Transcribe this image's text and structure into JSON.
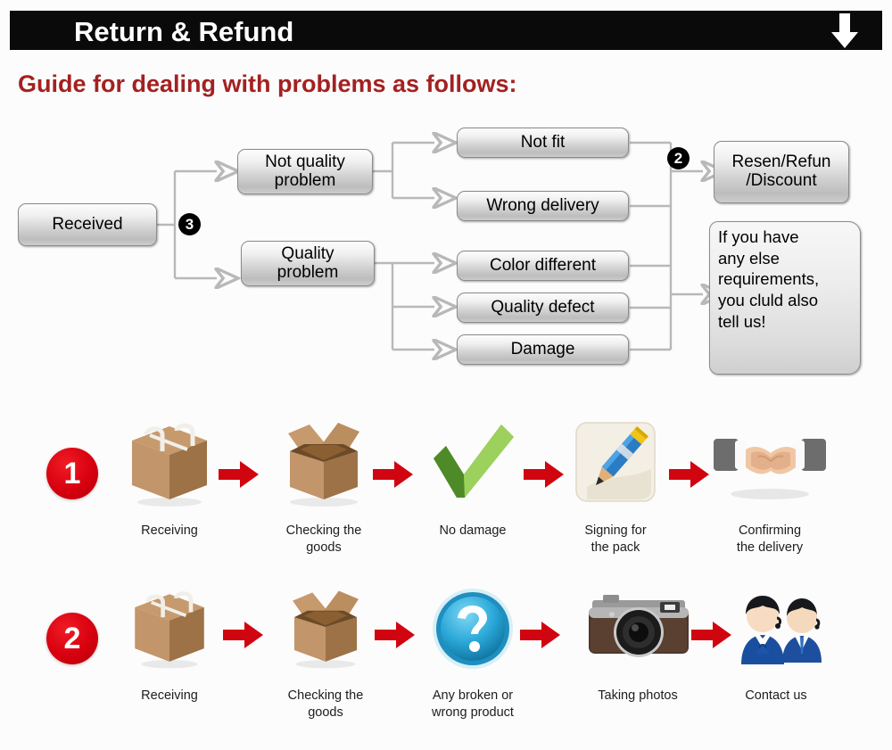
{
  "banner": {
    "title": "Return & Refund",
    "arrow_icon": "down-arrow-icon"
  },
  "guide": {
    "title": "Guide for dealing with problems as follows:"
  },
  "flowchart": {
    "badges": [
      {
        "id": "badge-3",
        "label": "3"
      },
      {
        "id": "badge-2",
        "label": "2"
      }
    ],
    "nodes": [
      {
        "id": "received",
        "label": "Received"
      },
      {
        "id": "not-quality",
        "label": "Not quality\nproblem"
      },
      {
        "id": "quality",
        "label": "Quality\nproblem"
      },
      {
        "id": "not-fit",
        "label": "Not fit"
      },
      {
        "id": "wrong-delivery",
        "label": "Wrong delivery"
      },
      {
        "id": "color-different",
        "label": "Color different"
      },
      {
        "id": "quality-defect",
        "label": "Quality defect"
      },
      {
        "id": "damage",
        "label": "Damage"
      },
      {
        "id": "resend-refund",
        "label": "Resen/Refun\n/Discount"
      },
      {
        "id": "contact-note",
        "label": "If you have\nany else\nrequirements,\nyou cluld also\ntell us!"
      }
    ]
  },
  "steps": {
    "rows": [
      {
        "badge": "1",
        "items": [
          {
            "icon": "closed-box-icon",
            "label": "Receiving"
          },
          {
            "icon": "open-box-icon",
            "label": "Checking the\ngoods"
          },
          {
            "icon": "green-check-icon",
            "label": "No damage"
          },
          {
            "icon": "pencil-sign-icon",
            "label": "Signing for\nthe pack"
          },
          {
            "icon": "handshake-icon",
            "label": "Confirming\nthe delivery"
          }
        ]
      },
      {
        "badge": "2",
        "items": [
          {
            "icon": "closed-box-icon",
            "label": "Receiving"
          },
          {
            "icon": "open-box-icon",
            "label": "Checking the\ngoods"
          },
          {
            "icon": "question-mark-icon",
            "label": "Any broken or\nwrong product"
          },
          {
            "icon": "camera-icon",
            "label": "Taking photos"
          },
          {
            "icon": "support-agents-icon",
            "label": "Contact us"
          }
        ]
      }
    ],
    "arrow_icon": "right-arrow-icon"
  },
  "colors": {
    "banner_bg": "#0a0a0a",
    "guide_text": "#a32121",
    "badge_red": "#d7000f",
    "arrow_red": "#d00510",
    "box_border": "#8b8b8b",
    "page_bg": "#fdfcfc"
  }
}
